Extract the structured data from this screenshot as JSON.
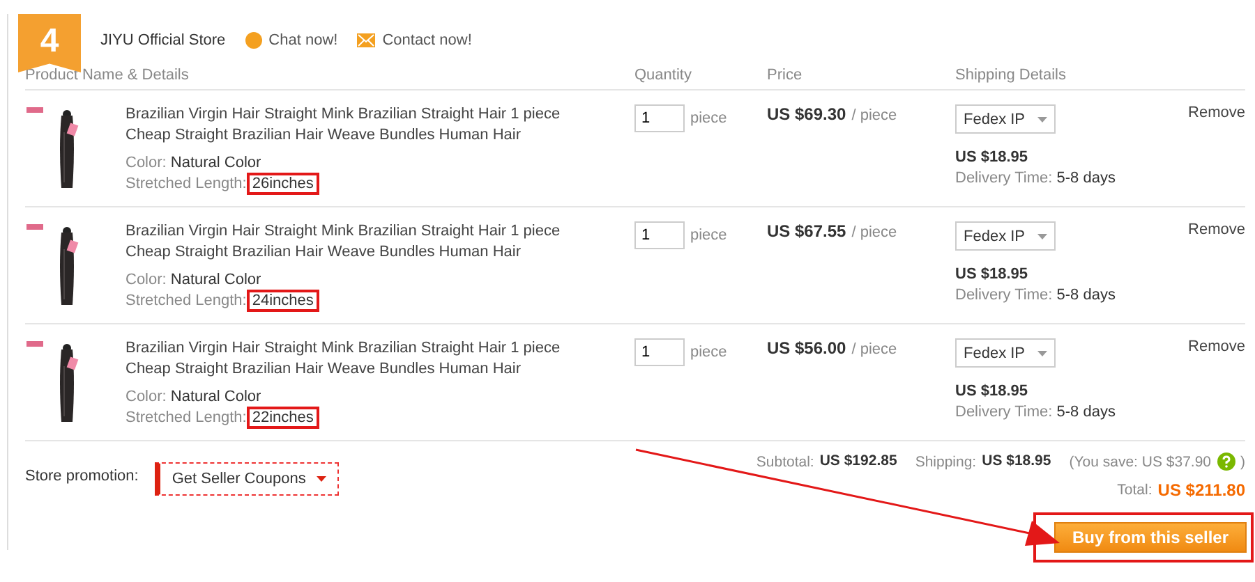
{
  "step_badge": "4",
  "store": {
    "name": "JIYU Official Store",
    "chat": "Chat now!",
    "contact": "Contact now!"
  },
  "columns": [
    "Product Name & Details",
    "Quantity",
    "Price",
    "Shipping Details"
  ],
  "items": [
    {
      "title": "Brazilian Virgin Hair Straight Mink Brazilian Straight Hair 1 piece Cheap Straight Brazilian Hair Weave Bundles Human Hair",
      "color_label": "Color:",
      "color_value": "Natural Color",
      "length_label": "Stretched Length:",
      "length_value": "26inches",
      "highlighted": true,
      "quantity": "1",
      "unit": "piece",
      "price": "US $69.30",
      "price_unit": "/ piece",
      "shipping_method": "Fedex IP",
      "shipping_cost": "US $18.95",
      "delivery_label": "Delivery Time:",
      "delivery_value": "5-8 days",
      "remove": "Remove"
    },
    {
      "title": "Brazilian Virgin Hair Straight Mink Brazilian Straight Hair 1 piece Cheap Straight Brazilian Hair Weave Bundles Human Hair",
      "color_label": "Color:",
      "color_value": "Natural Color",
      "length_label": "Stretched Length:",
      "length_value": "24inches",
      "highlighted": true,
      "quantity": "1",
      "unit": "piece",
      "price": "US $67.55",
      "price_unit": "/ piece",
      "shipping_method": "Fedex IP",
      "shipping_cost": "US $18.95",
      "delivery_label": "Delivery Time:",
      "delivery_value": "5-8 days",
      "remove": "Remove"
    },
    {
      "title": "Brazilian Virgin Hair Straight Mink Brazilian Straight Hair 1 piece Cheap Straight Brazilian Hair Weave Bundles Human Hair",
      "color_label": "Color:",
      "color_value": "Natural Color",
      "length_label": "Stretched Length:",
      "length_value": "22inches",
      "highlighted": true,
      "quantity": "1",
      "unit": "piece",
      "price": "US $56.00",
      "price_unit": "/ piece",
      "shipping_method": "Fedex IP",
      "shipping_cost": "US $18.95",
      "delivery_label": "Delivery Time:",
      "delivery_value": "5-8 days",
      "remove": "Remove"
    }
  ],
  "footer": {
    "promotion_label": "Store promotion:",
    "coupon_button": "Get Seller Coupons",
    "subtotal_label": "Subtotal:",
    "subtotal": "US $192.85",
    "shipping_label": "Shipping:",
    "shipping": "US $18.95",
    "save_text": "(You save: US $37.90",
    "save_close": ")",
    "total_label": "Total:",
    "total": "US $211.80",
    "buy_button": "Buy from this seller",
    "buy_highlighted": true
  }
}
